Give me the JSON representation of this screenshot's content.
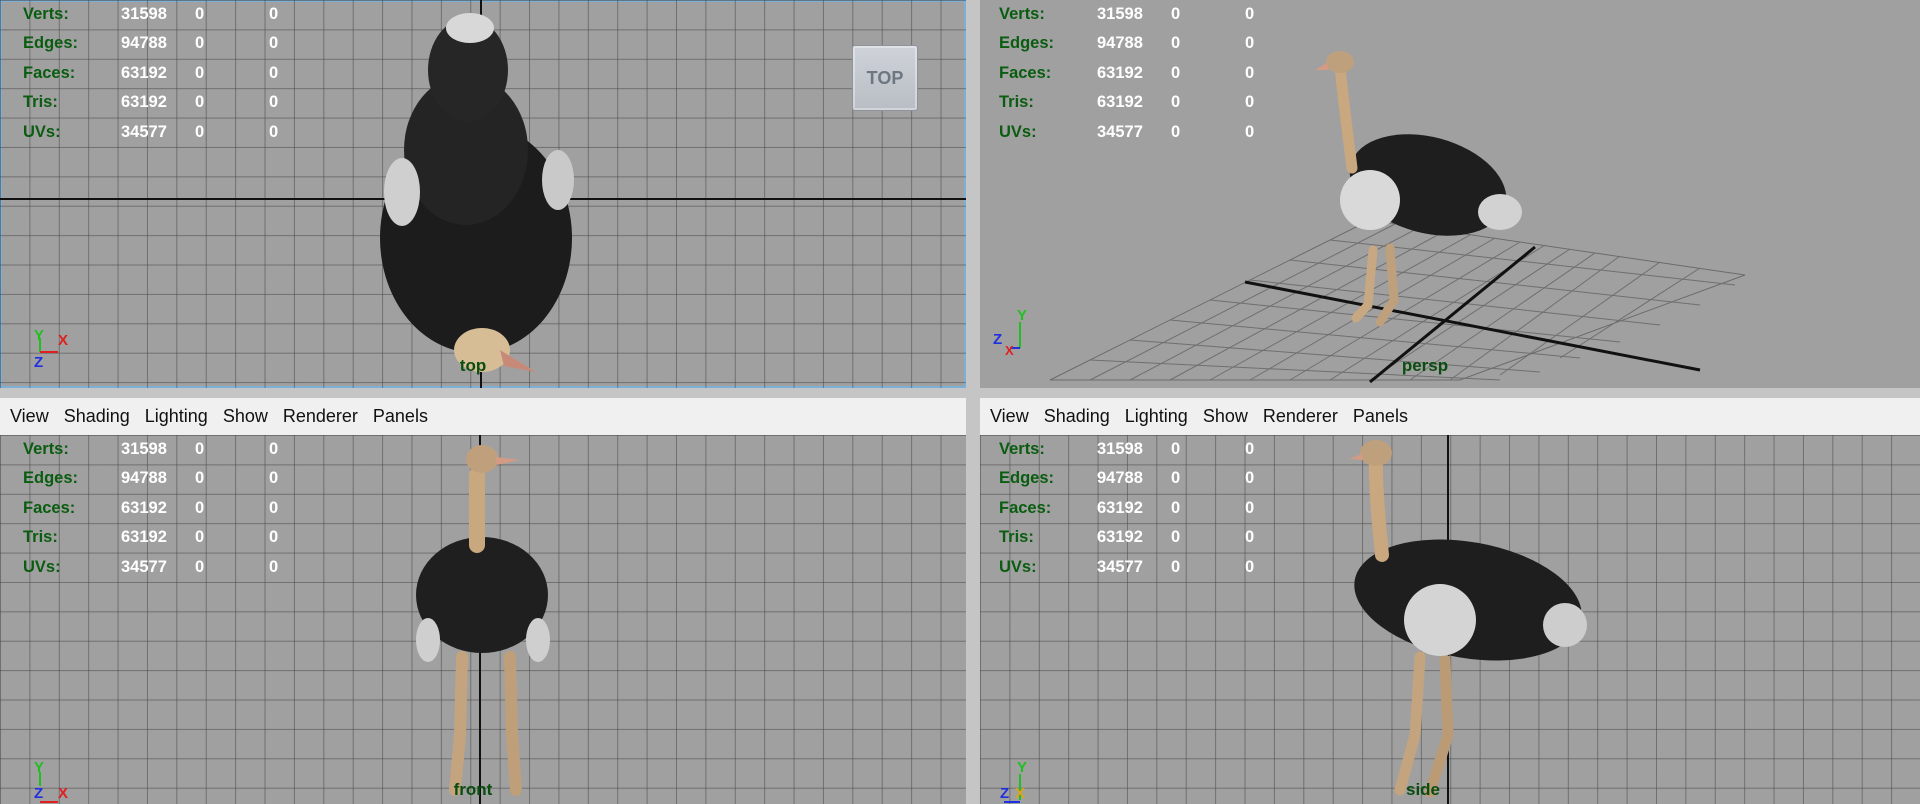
{
  "menu_labels": [
    "View",
    "Shading",
    "Lighting",
    "Show",
    "Renderer",
    "Panels"
  ],
  "hud_labels": [
    "Verts:",
    "Edges:",
    "Faces:",
    "Tris:",
    "UVs:"
  ],
  "hud_values": [
    [
      "31598",
      "0",
      "0"
    ],
    [
      "94788",
      "0",
      "0"
    ],
    [
      "63192",
      "0",
      "0"
    ],
    [
      "63192",
      "0",
      "0"
    ],
    [
      "34577",
      "0",
      "0"
    ]
  ],
  "viewports": {
    "top": {
      "camera": "top",
      "viewcube": "TOP",
      "gizmo": [
        "Y",
        "X",
        "Z"
      ]
    },
    "persp": {
      "camera": "persp",
      "gizmo": [
        "Y",
        "Z",
        "X"
      ]
    },
    "front": {
      "camera": "front",
      "gizmo": [
        "Y",
        "Z",
        "X"
      ]
    },
    "side": {
      "camera": "side",
      "gizmo": [
        "Y",
        "Z",
        "X"
      ]
    }
  },
  "colors": {
    "viewport_bg": "#a0a0a0",
    "hud_label": "#0a5d10",
    "axis_x": "#e02020",
    "axis_y": "#20c020",
    "axis_z": "#2030e0",
    "active_border": "#7db0d6"
  }
}
